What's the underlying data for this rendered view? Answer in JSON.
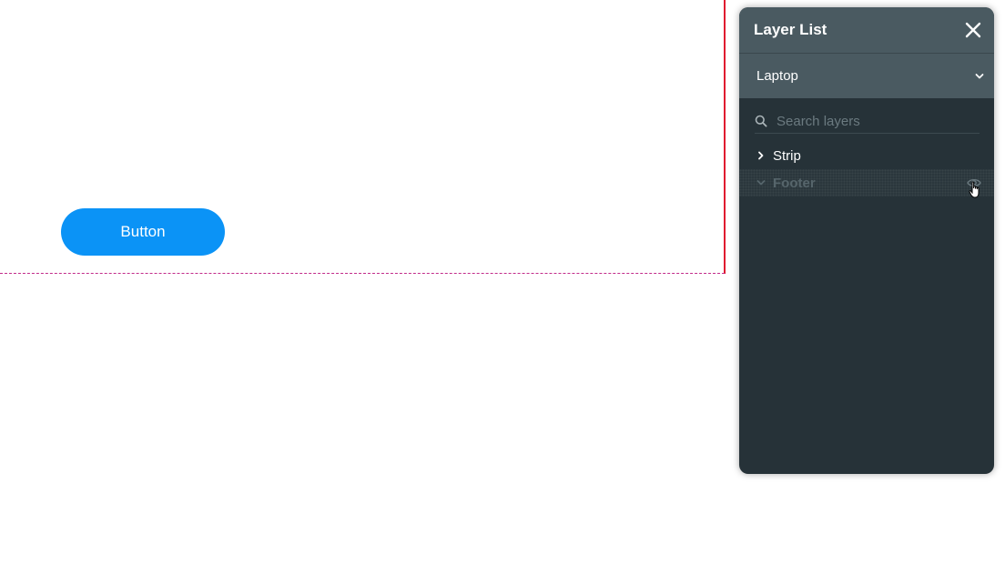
{
  "canvas": {
    "button_label": "Button"
  },
  "layer_panel": {
    "title": "Layer List",
    "device": "Laptop",
    "search": {
      "placeholder": "Search layers",
      "value": ""
    },
    "layers": [
      {
        "name": "Strip",
        "state": "collapsed",
        "hidden": false
      },
      {
        "name": "Footer",
        "state": "expanded",
        "hidden": true
      }
    ]
  },
  "colors": {
    "accent_button": "#0b93f6",
    "panel_bg": "#263238",
    "panel_header": "#4a5a61",
    "guide_vertical": "#e0192f",
    "guide_horizontal": "#c22b8a"
  },
  "icons": [
    "close-icon",
    "chevron-down-icon",
    "search-icon",
    "chevron-right-icon",
    "eye-icon",
    "hand-cursor-icon"
  ]
}
